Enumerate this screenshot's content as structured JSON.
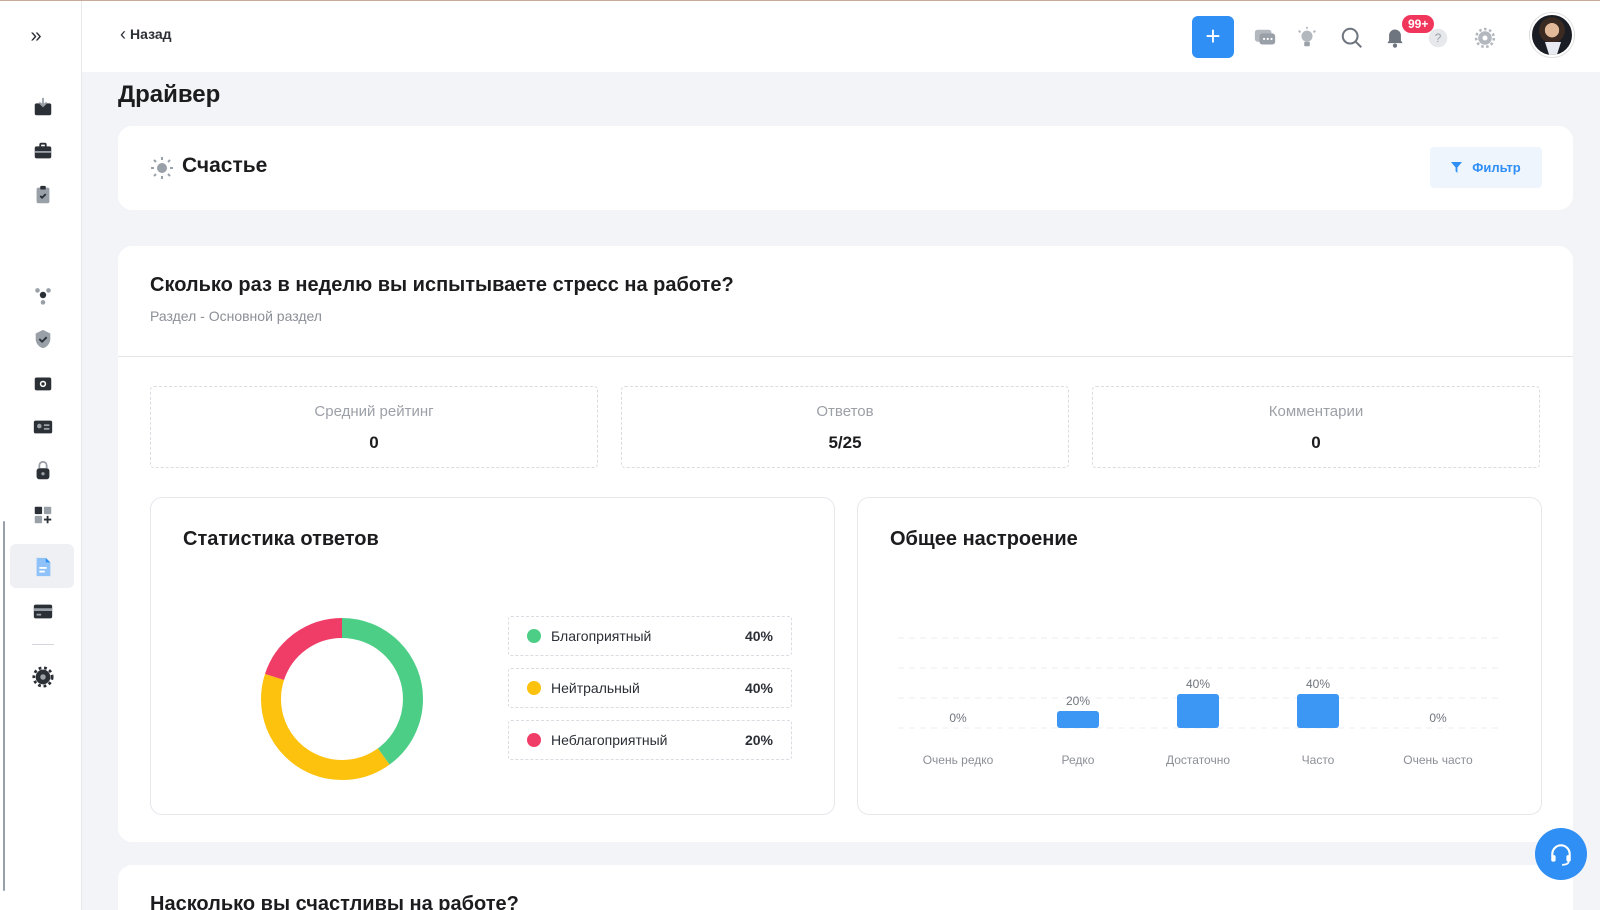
{
  "header": {
    "back_label": "Назад",
    "add_label": "+",
    "notifications_badge": "99+"
  },
  "page": {
    "title": "Драйвер"
  },
  "section": {
    "title": "Счастье",
    "filter_label": "Фильтр"
  },
  "question": {
    "title": "Сколько раз в неделю вы испытываете стресс на работе?",
    "subtitle": "Раздел - Основной раздел",
    "stats": [
      {
        "label": "Средний рейтинг",
        "value": "0"
      },
      {
        "label": "Ответов",
        "value": "5/25"
      },
      {
        "label": "Комментарии",
        "value": "0"
      }
    ]
  },
  "answer_stats": {
    "title": "Статистика ответов",
    "legend": [
      {
        "name": "Благоприятный",
        "pct": "40%",
        "color": "#4cce86"
      },
      {
        "name": "Нейтральный",
        "pct": "40%",
        "color": "#fdc20d"
      },
      {
        "name": "Неблагоприятный",
        "pct": "20%",
        "color": "#ef3d68"
      }
    ]
  },
  "mood": {
    "title": "Общее настроение"
  },
  "chart_data": [
    {
      "type": "pie",
      "labels": [
        "Благоприятный",
        "Нейтральный",
        "Неблагоприятный"
      ],
      "values": [
        40,
        40,
        20
      ],
      "colors": [
        "#4cce86",
        "#fdc20d",
        "#ef3d68"
      ]
    },
    {
      "type": "bar",
      "categories": [
        "Очень редко",
        "Редко",
        "Достаточно",
        "Часто",
        "Очень часто"
      ],
      "values": [
        0,
        20,
        40,
        40,
        0
      ],
      "data_labels": [
        "0%",
        "20%",
        "40%",
        "40%",
        "0%"
      ],
      "ylim": [
        0,
        40
      ],
      "grid": true,
      "color": "#3c96f3"
    }
  ],
  "next_question": {
    "title": "Насколько вы счастливы на работе?"
  }
}
